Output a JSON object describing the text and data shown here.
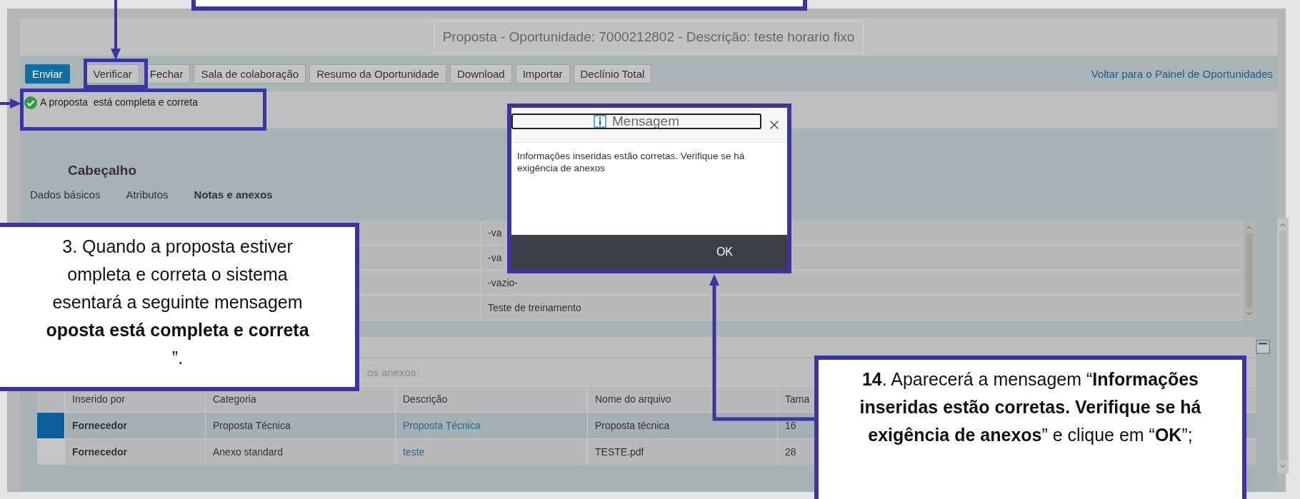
{
  "page_title": "Proposta - Oportunidade: 7000212802 - Descrição: teste horario fixo",
  "toolbar": {
    "buttons": [
      {
        "label": "Enviar",
        "kind": "primary"
      },
      {
        "label": "Verificar",
        "kind": "default"
      },
      {
        "label": "Fechar",
        "kind": "default"
      },
      {
        "label": "Sala de colaboração",
        "kind": "default"
      },
      {
        "label": "Resumo da Oportunidade",
        "kind": "default"
      },
      {
        "label": "Download",
        "kind": "default"
      },
      {
        "label": "Importar",
        "kind": "default"
      },
      {
        "label": "Declínio Total",
        "kind": "default"
      }
    ],
    "link": "Voltar para o Painel de Oportunidades"
  },
  "status_message": {
    "kind": "success",
    "text": "A proposta  está completa e correta"
  },
  "section_title": "Cabeçalho",
  "tabs": [
    {
      "label": "Dados básicos",
      "selected": false
    },
    {
      "label": "Atributos",
      "selected": false
    },
    {
      "label": "Notas e anexos",
      "selected": true
    }
  ],
  "header_table": {
    "rows": [
      {
        "value": "-va"
      },
      {
        "value": "-va"
      },
      {
        "value": "-vazio-"
      },
      {
        "value": "Teste de treinamento"
      }
    ]
  },
  "attachments": {
    "button": "os anexos",
    "columns": [
      "Inserido por",
      "Categoria",
      "Descrição",
      "Nome do arquivo",
      "Tama"
    ],
    "rows": [
      {
        "selected": true,
        "cells": [
          "Fornecedor",
          "Proposta Técnica",
          "Proposta Técnica",
          "Proposta técnica",
          "16"
        ]
      },
      {
        "selected": false,
        "cells": [
          "Fornecedor",
          "Anexo standard",
          "teste",
          "TESTE.pdf",
          "28"
        ]
      }
    ]
  },
  "dialog": {
    "title": "Mensagem",
    "message": "Informações inseridas estão corretas. Verifique se há exigência de anexos",
    "button": "OK"
  },
  "callouts": {
    "left_lines": [
      "3. Quando a proposta estiver",
      "ompleta e correta o sistema",
      "esentará a seguinte mensagem",
      "**oposta está completa e correta**",
      "”."
    ],
    "right_text": "**14**. Aparecerá a mensagem “**Informações inseridas estão corretas. Verifique se há exigência de anexos**” e clique em “**OK**”;"
  }
}
